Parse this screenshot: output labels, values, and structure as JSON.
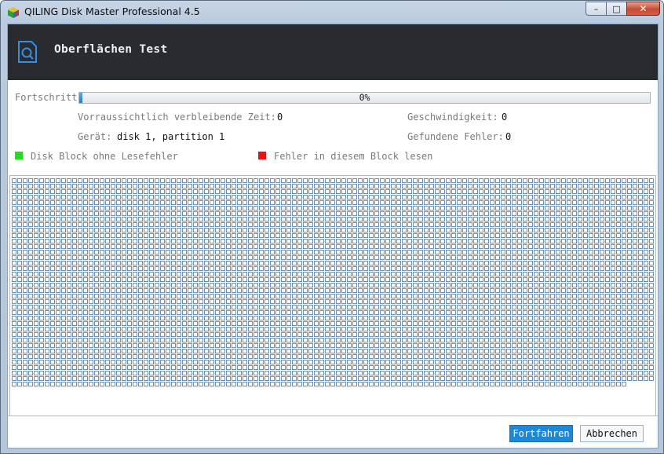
{
  "window": {
    "title": "QILING Disk Master Professional 4.5",
    "controls": {
      "minimize": "–",
      "maximize": "□",
      "close": "✕"
    }
  },
  "header": {
    "title": "Oberflächen Test",
    "icon": "disk-scan-icon"
  },
  "progress": {
    "label": "Fortschritt",
    "percent_text": "0%",
    "value": 0.003
  },
  "stats": {
    "remaining_label": "Vorraussichtlich verbleibende Zeit:",
    "remaining_value": "0",
    "speed_label": "Geschwindigkeit:",
    "speed_value": "0",
    "device_label": "Gerät:",
    "device_value": "disk 1, partition 1",
    "errors_label": "Gefundene Fehler:",
    "errors_value": "0"
  },
  "legend": {
    "ok_label": "Disk Block ohne Lesefehler",
    "ok_color": "#22dd22",
    "error_label": "Fehler in diesem Block lesen",
    "error_color": "#ee1111"
  },
  "block_grid": {
    "cell_color": "#6f8fb0",
    "full_rows": 37,
    "last_row_fraction": 0.96
  },
  "buttons": {
    "continue": "Fortfahren",
    "cancel": "Abbrechen"
  }
}
